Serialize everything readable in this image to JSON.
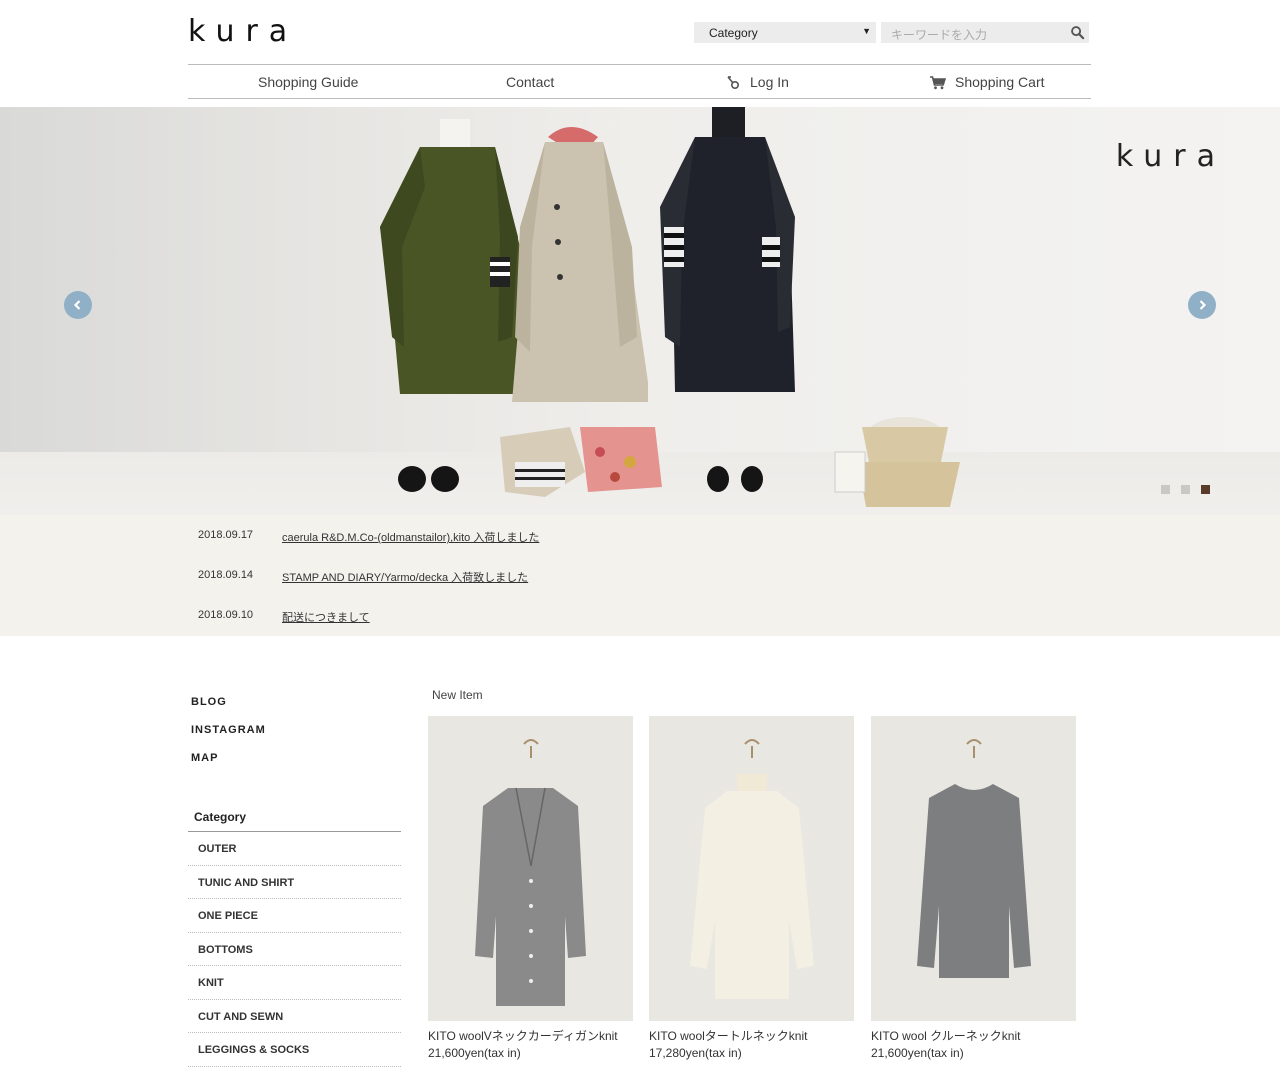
{
  "header": {
    "logo": "kura",
    "category_select": "Category",
    "search_placeholder": "キーワードを入力"
  },
  "nav": {
    "shopping_guide": "Shopping Guide",
    "contact": "Contact",
    "login": "Log In",
    "cart": "Shopping Cart"
  },
  "hero": {
    "logo": "kura",
    "slides_total": 3,
    "active_slide": 3
  },
  "news": [
    {
      "date": "2018.09.17",
      "title": "caerula R&D.M.Co-(oldmanstailor),kito 入荷しました"
    },
    {
      "date": "2018.09.14",
      "title": "STAMP AND DIARY/Yarmo/decka 入荷致しました"
    },
    {
      "date": "2018.09.10",
      "title": "配送につきまして"
    }
  ],
  "sidebar": {
    "links": [
      "BLOG",
      "INSTAGRAM",
      "MAP"
    ],
    "category_heading": "Category",
    "categories": [
      "OUTER",
      "TUNIC AND SHIRT",
      "ONE PIECE",
      "BOTTOMS",
      "KNIT",
      "CUT AND SEWN",
      "LEGGINGS & SOCKS"
    ]
  },
  "new_items": {
    "heading": "New Item",
    "items": [
      {
        "name": "KITO woolVネックカーディガンknit",
        "price": "21,600yen(tax in)",
        "color": "#8a8a8a"
      },
      {
        "name": "KITO woolタートルネックknit",
        "price": "17,280yen(tax in)",
        "color": "#f3efe2"
      },
      {
        "name": "KITO wool クルーネックknit",
        "price": "21,600yen(tax in)",
        "color": "#7d7e80"
      }
    ]
  },
  "colors": {
    "accent_arrow": "#8fb0c7",
    "news_bg": "#f3f2ed",
    "active_dot": "#5a3a28"
  },
  "icons": {
    "search": "search-icon",
    "login": "login-icon",
    "cart": "cart-icon",
    "prev": "chevron-left-icon",
    "next": "chevron-right-icon"
  }
}
